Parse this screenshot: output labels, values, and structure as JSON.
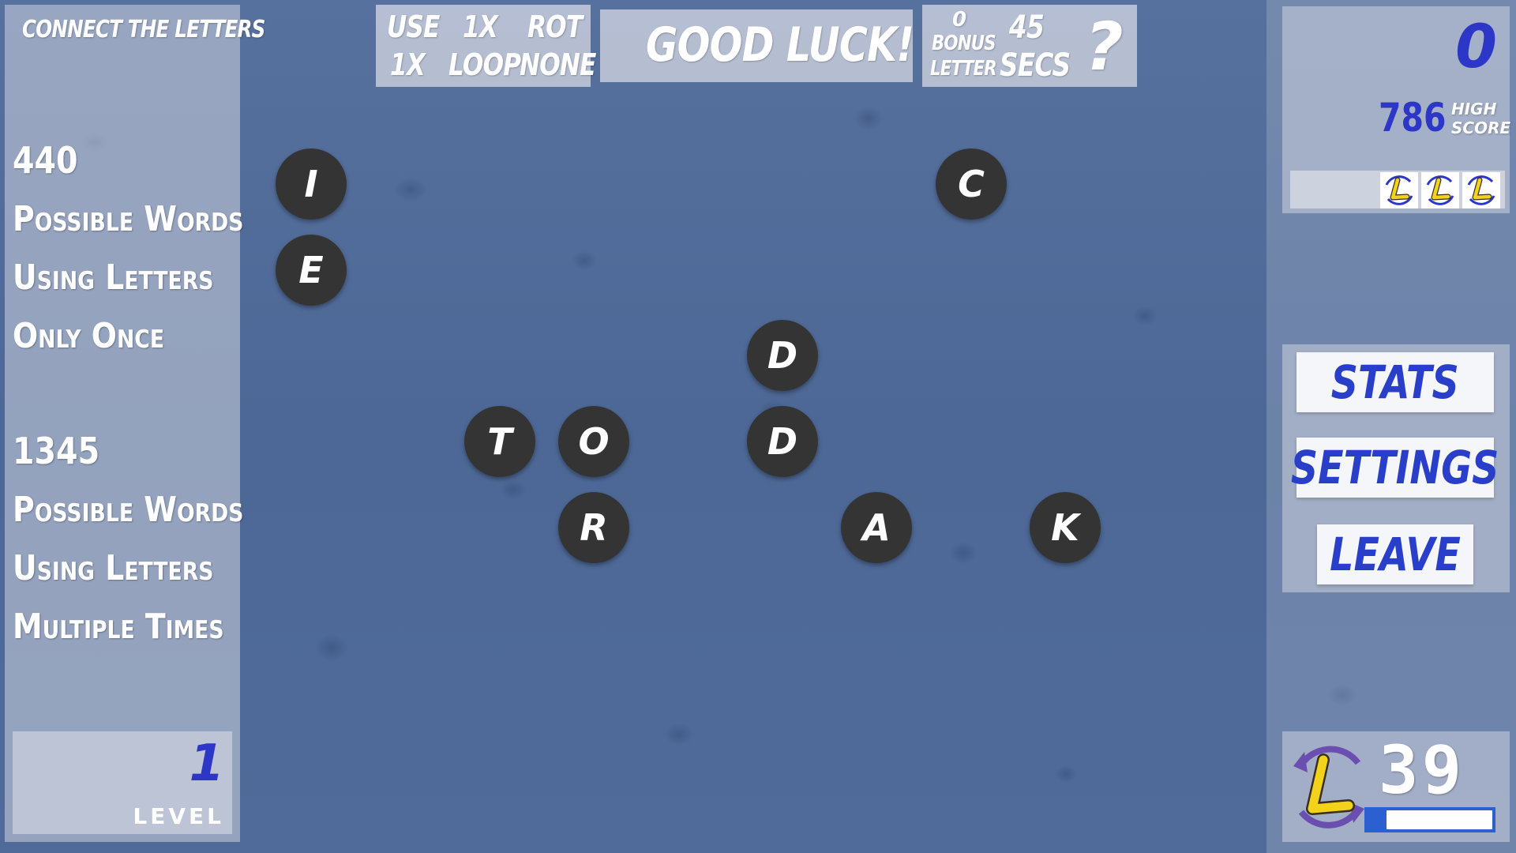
{
  "title": "CONNECT THE LETTERS",
  "left_panel": {
    "once_count": "440",
    "once_lines": [
      "Possible Words",
      "Using Letters",
      "Only Once"
    ],
    "multi_count": "1345",
    "multi_lines": [
      "Possible Words",
      "Using Letters",
      "Multiple Times"
    ],
    "level_value": "1",
    "level_label": "LEVEL"
  },
  "top_bar": {
    "use_label": "USE",
    "use_value": "1X",
    "rot_label": "ROT",
    "use_value_2": "1X",
    "loop_label": "LOOP",
    "rot_value": "NONE",
    "message": "GOOD LUCK!",
    "bonus_count": "0",
    "bonus_label_1": "BONUS",
    "bonus_label_2": "LETTER",
    "seconds_value": "45",
    "seconds_label": "SECS",
    "help": "?"
  },
  "tiles": [
    "I",
    "E",
    "C",
    "D",
    "T",
    "O",
    "D",
    "R",
    "A",
    "K"
  ],
  "score_panel": {
    "score": "0",
    "high_score": "786",
    "high_label_1": "HIGH",
    "high_label_2": "SCORE",
    "lives": 3
  },
  "menu": {
    "stats": "STATS",
    "settings": "SETTINGS",
    "leave": "LEAVE"
  },
  "timer": {
    "value": "39",
    "progress": 0.85
  },
  "colors": {
    "accent": "#2c36c7",
    "tile": "#343434",
    "logo_yellow": "#f2d21b",
    "logo_purple": "#6a4fb0"
  },
  "icons": {
    "life": "l-logo-icon",
    "rotate": "rotate-l-icon"
  }
}
